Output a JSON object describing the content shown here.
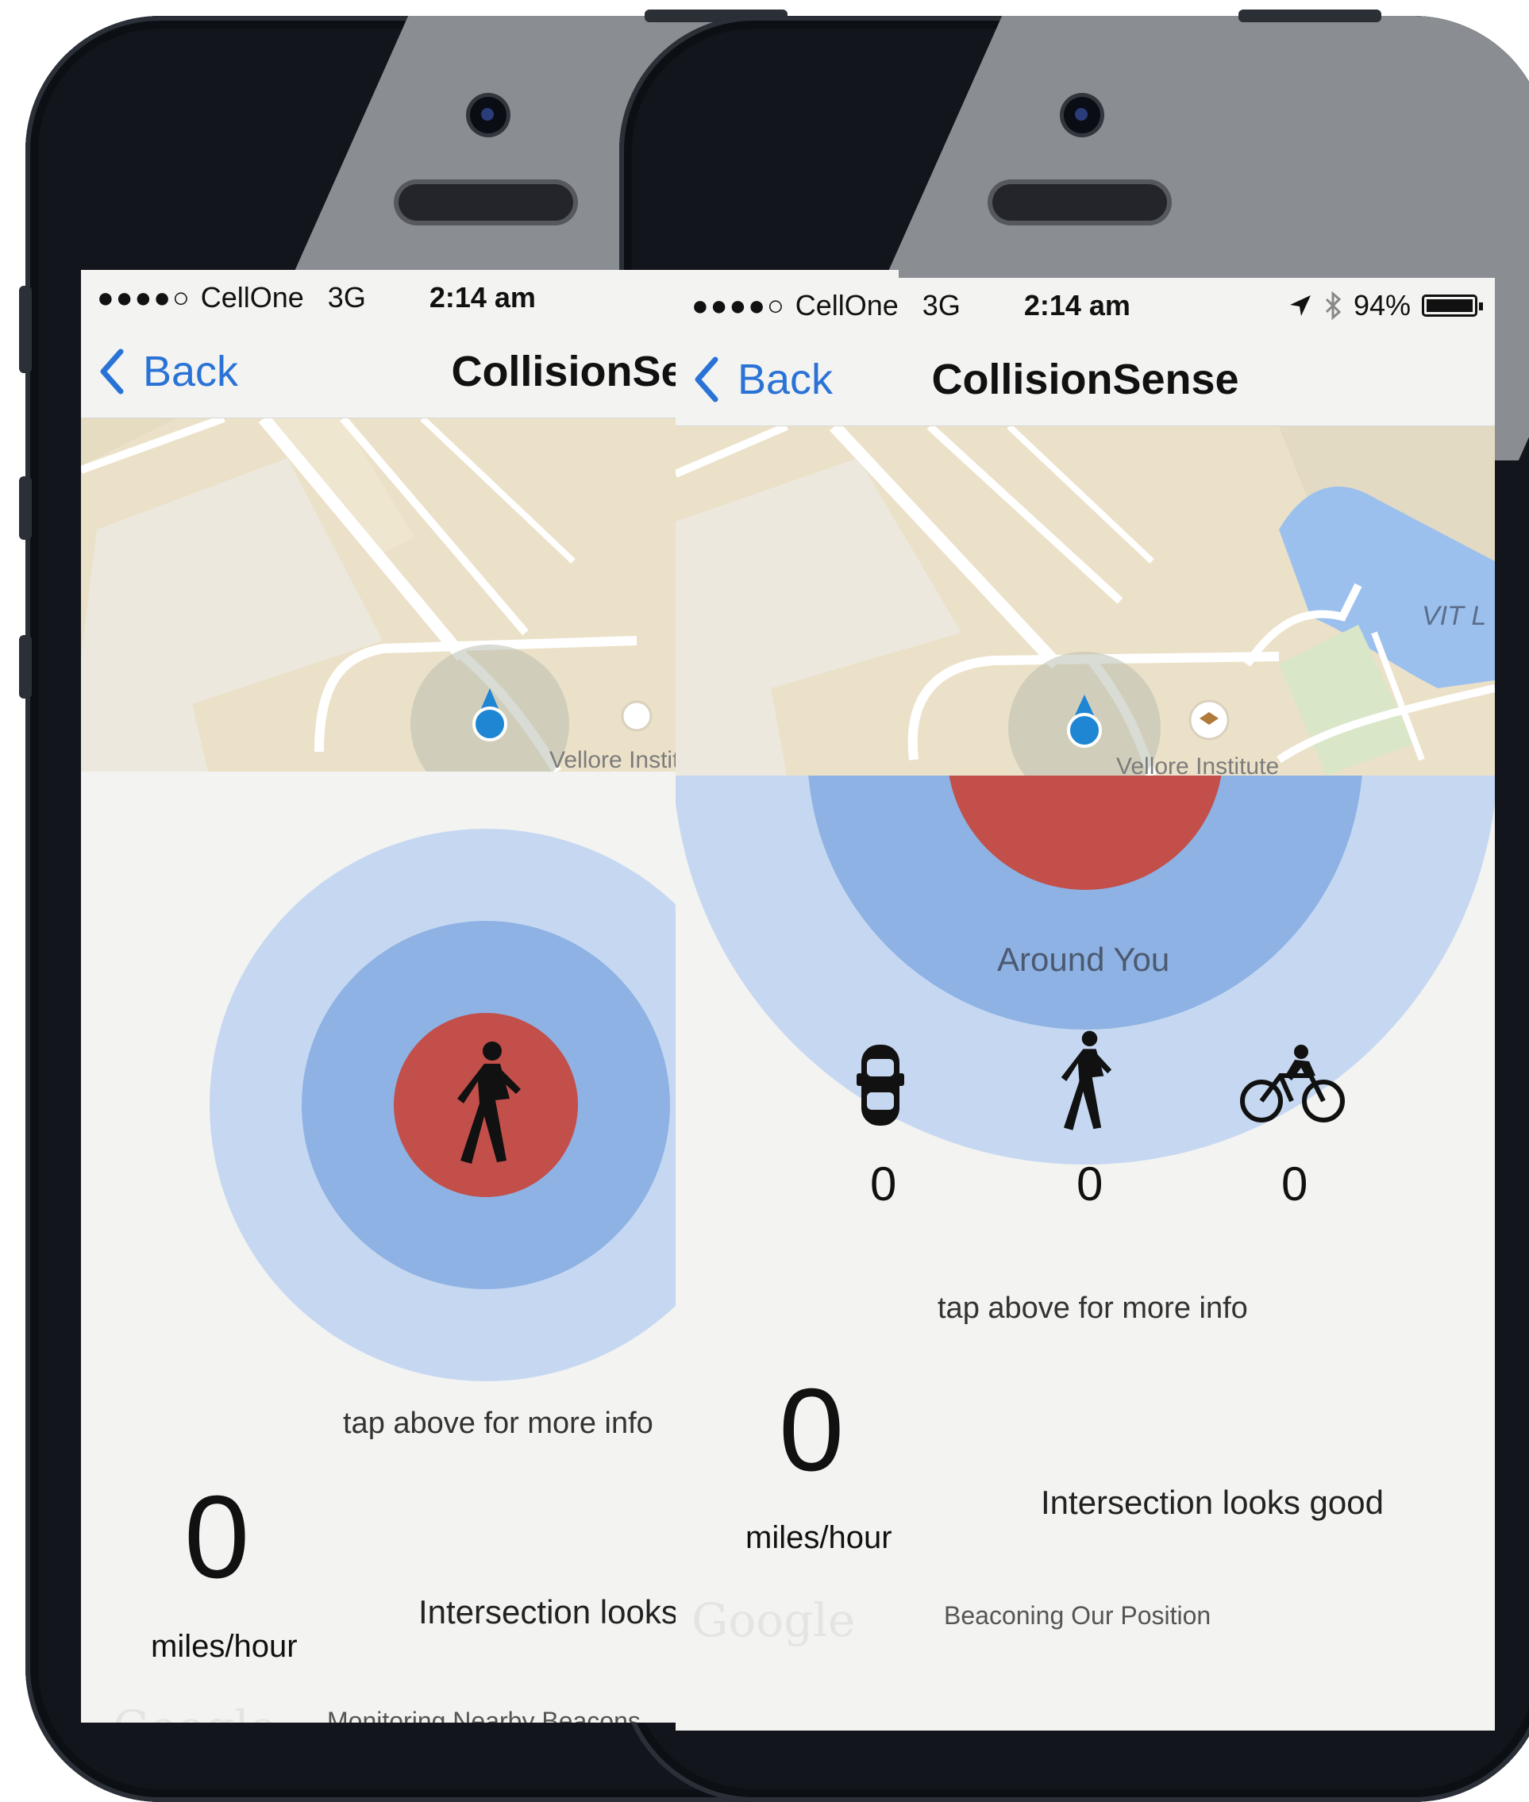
{
  "left_phone": {
    "status": {
      "signal": "●●●●○",
      "carrier": "CellOne",
      "network": "3G",
      "time": "2:14 am"
    },
    "nav": {
      "back_label": "Back",
      "title": "CollisionSense"
    },
    "map": {
      "place_label": "Vellore Institute of Technology"
    },
    "tap_hint": "tap above for more info",
    "speed": {
      "value": "0",
      "unit": "miles/hour"
    },
    "message": "Intersection looks good",
    "beacon_status": "Monitoring Nearby Beacons",
    "center_icon": "pedestrian-icon"
  },
  "right_phone": {
    "status": {
      "signal": "●●●●○",
      "carrier": "CellOne",
      "network": "3G",
      "time": "2:14 am",
      "battery": "94%"
    },
    "nav": {
      "back_label": "Back",
      "title": "CollisionSense"
    },
    "map": {
      "place_label": "Vellore Institute",
      "area_label": "VIT L"
    },
    "around_label": "Around You",
    "categories": [
      {
        "icon": "car-icon",
        "count": "0"
      },
      {
        "icon": "pedestrian-icon",
        "count": "0"
      },
      {
        "icon": "bicycle-icon",
        "count": "0"
      }
    ],
    "tap_hint": "tap above for more info",
    "speed": {
      "value": "0",
      "unit": "miles/hour"
    },
    "message": "Intersection looks good",
    "beacon_status": "Beaconing Our Position"
  },
  "map_attribution": "Google",
  "colors": {
    "accent": "#2a73d6",
    "ring_outer": "#c6d8f1",
    "ring_mid": "#8eb2e4",
    "alert": "#c24f4a"
  }
}
